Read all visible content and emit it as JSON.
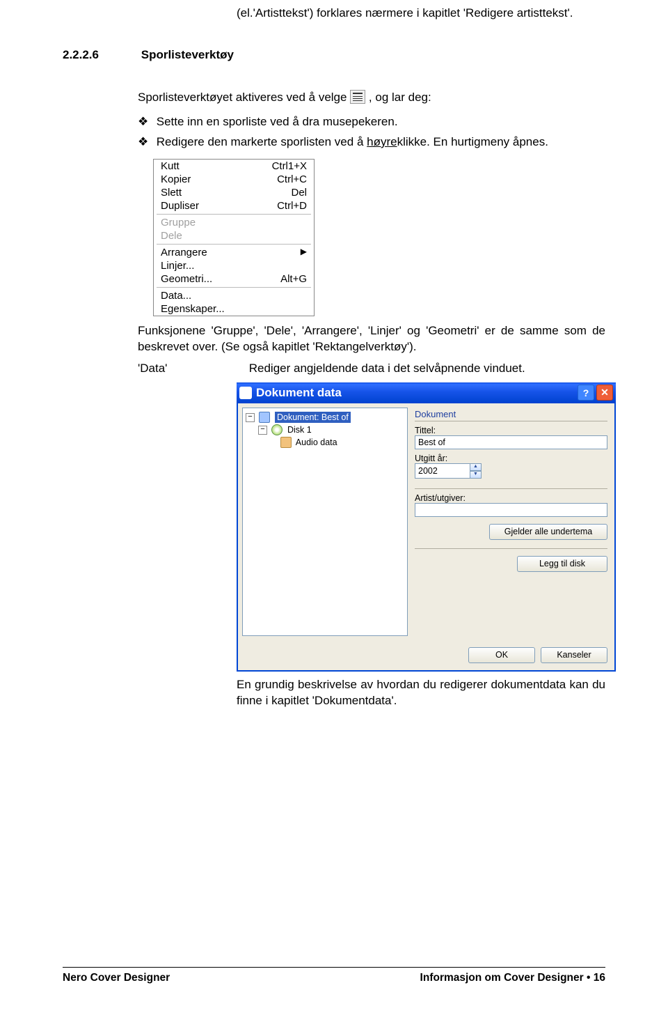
{
  "intro_block": "(el.'Artisttekst') forklares nærmere i kapitlet 'Redigere artisttekst'.",
  "section": {
    "number": "2.2.2.6",
    "title": "Sporlisteverktøy"
  },
  "para1_before_icon": "Sporlisteverktøyet aktiveres ved å velge ",
  "para1_after_icon": ", og lar deg:",
  "bullets": [
    "Sette inn en sporliste ved å dra musepekeren.",
    "Redigere den markerte sporlisten ved å høyreklikke. En hurtigmeny åpnes."
  ],
  "menu": {
    "items_top": [
      {
        "label": "Kutt",
        "shortcut": "Ctrl1+X"
      },
      {
        "label": "Kopier",
        "shortcut": "Ctrl+C"
      },
      {
        "label": "Slett",
        "shortcut": "Del"
      },
      {
        "label": "Dupliser",
        "shortcut": "Ctrl+D"
      }
    ],
    "disabled": [
      {
        "label": "Gruppe"
      },
      {
        "label": "Dele"
      }
    ],
    "mid": [
      {
        "label": "Arrangere",
        "arrow": "▶"
      },
      {
        "label": "Linjer..."
      },
      {
        "label": "Geometri...",
        "shortcut": "Alt+G"
      }
    ],
    "bottom": [
      {
        "label": "Data..."
      },
      {
        "label": "Egenskaper..."
      }
    ]
  },
  "para_after_menu": "Funksjonene 'Gruppe', 'Dele', 'Arrangere', 'Linjer' og 'Geometri' er de samme som de beskrevet over. (Se også kapitlet 'Rektangelverktøy').",
  "data_label": "'Data'",
  "data_desc": "Rediger angjeldende data i det selvåpnende vinduet.",
  "dialog": {
    "title": "Dokument data",
    "tree": {
      "node1": "Dokument: Best of",
      "node2": "Disk 1",
      "node3": "Audio data"
    },
    "group_doc": "Dokument",
    "title_label": "Tittel:",
    "title_value": "Best of",
    "year_label": "Utgitt år:",
    "year_value": "2002",
    "artist_label": "Artist/utgiver:",
    "btn_subtopic": "Gjelder alle undertema",
    "btn_add_disk": "Legg til disk",
    "btn_ok": "OK",
    "btn_cancel": "Kanseler"
  },
  "closing": "En grundig beskrivelse av hvordan du redigerer dokumentdata kan du finne i kapitlet 'Dokumentdata'.",
  "footer": {
    "left": "Nero Cover Designer",
    "right_left": "Informasjon om Cover Designer",
    "bullet": "•",
    "page": "16"
  }
}
